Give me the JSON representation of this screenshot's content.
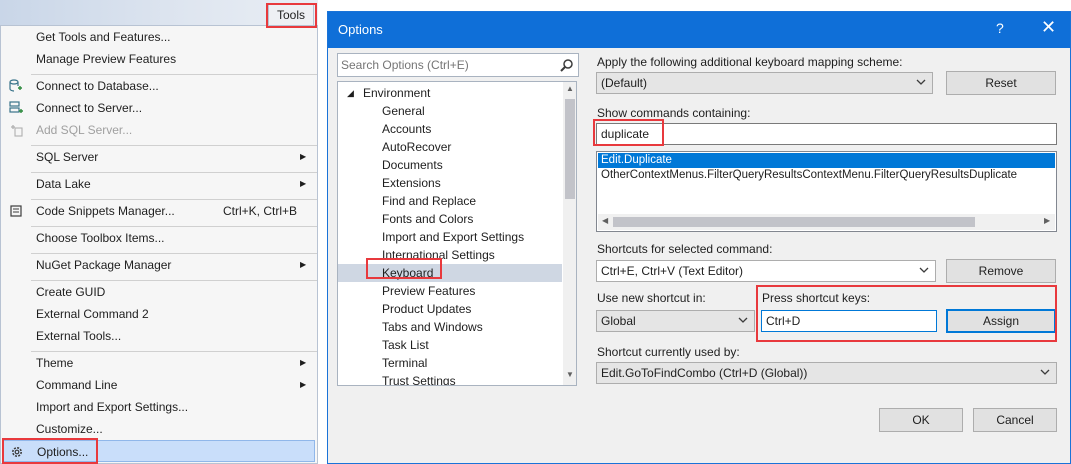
{
  "menu": {
    "tab_label": "Tools",
    "items": [
      {
        "label": "Get Tools and Features..."
      },
      {
        "label": "Manage Preview Features"
      },
      {
        "label": "Connect to Database..."
      },
      {
        "label": "Connect to Server..."
      },
      {
        "label": "Add SQL Server..."
      },
      {
        "label": "SQL Server"
      },
      {
        "label": "Data Lake"
      },
      {
        "label": "Code Snippets Manager...",
        "shortcut": "Ctrl+K, Ctrl+B"
      },
      {
        "label": "Choose Toolbox Items..."
      },
      {
        "label": "NuGet Package Manager"
      },
      {
        "label": "Create GUID"
      },
      {
        "label": "External Command 2"
      },
      {
        "label": "External Tools..."
      },
      {
        "label": "Theme"
      },
      {
        "label": "Command Line"
      },
      {
        "label": "Import and Export Settings..."
      },
      {
        "label": "Customize..."
      },
      {
        "label": "Options..."
      }
    ]
  },
  "dialog": {
    "title": "Options",
    "help_glyph": "?",
    "close_glyph": "✕",
    "search_placeholder": "Search Options (Ctrl+E)",
    "tree": {
      "root": "Environment",
      "items": [
        "General",
        "Accounts",
        "AutoRecover",
        "Documents",
        "Extensions",
        "Find and Replace",
        "Fonts and Colors",
        "Import and Export Settings",
        "International Settings",
        "Keyboard",
        "Preview Features",
        "Product Updates",
        "Tabs and Windows",
        "Task List",
        "Terminal",
        "Trust Settings"
      ],
      "selected": "Keyboard"
    },
    "mapping_label": "Apply the following additional keyboard mapping scheme:",
    "mapping_value": "(Default)",
    "reset_label": "Reset",
    "show_commands_label": "Show commands containing:",
    "show_commands_value": "duplicate",
    "commands": [
      "Edit.Duplicate",
      "OtherContextMenus.FilterQueryResultsContextMenu.FilterQueryResultsDuplicate"
    ],
    "shortcuts_label": "Shortcuts for selected command:",
    "shortcuts_value": "Ctrl+E, Ctrl+V (Text Editor)",
    "remove_label": "Remove",
    "use_new_label": "Use new shortcut in:",
    "use_new_value": "Global",
    "press_keys_label": "Press shortcut keys:",
    "press_keys_value": "Ctrl+D",
    "assign_label": "Assign",
    "used_by_label": "Shortcut currently used by:",
    "used_by_value": "Edit.GoToFindCombo (Ctrl+D (Global))",
    "ok_label": "OK",
    "cancel_label": "Cancel"
  },
  "colors": {
    "title_bar": "#0f6fd8",
    "highlight_box": "#e8393d",
    "selection": "#0078d7"
  },
  "icons": [
    "connect-database-icon",
    "connect-server-icon",
    "add-sql-server-icon",
    "code-snippets-icon",
    "gear-icon",
    "search-icon",
    "chevron-down-icon",
    "submenu-arrow-icon"
  ]
}
